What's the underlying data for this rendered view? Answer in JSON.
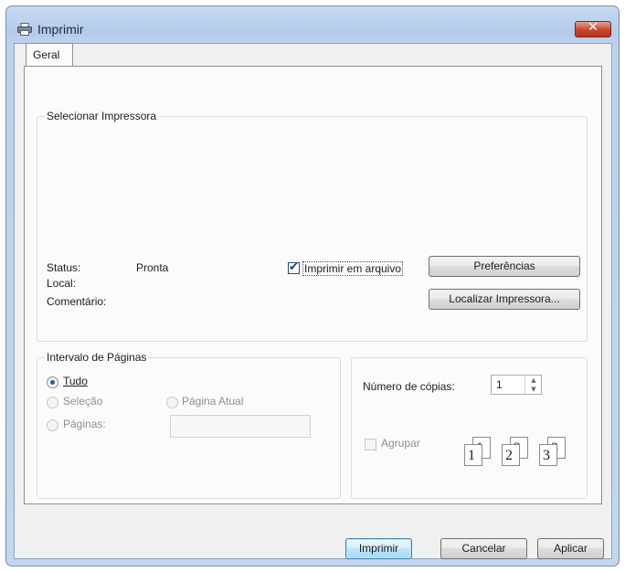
{
  "window": {
    "title": "Imprimir",
    "close_symbol": "✕"
  },
  "tabs": [
    {
      "label": "Geral"
    }
  ],
  "printer_group": {
    "legend": "Selecionar Impressora",
    "status_label": "Status:",
    "status_value": "Pronta",
    "location_label": "Local:",
    "comment_label": "Comentário:",
    "print_to_file_label": "Imprimir em arquivo",
    "print_to_file_checked": true,
    "preferences_button": "Preferências",
    "find_printer_button": "Localizar Impressora..."
  },
  "page_range": {
    "legend": "Intervalo de Páginas",
    "all_label": "Tudo",
    "selection_label": "Seleção",
    "current_page_label": "Página Atual",
    "pages_label": "Páginas:",
    "pages_value": ""
  },
  "copies": {
    "count_label": "Número de cópias:",
    "count_value": "1",
    "collate_label": "Agrupar",
    "collate_checked": false,
    "collate_pages": [
      "1",
      "1",
      "2",
      "2",
      "3",
      "3"
    ]
  },
  "footer": {
    "print_button": "Imprimir",
    "cancel_button": "Cancelar",
    "apply_button": "Aplicar"
  },
  "icons": {
    "printer": "printer-icon",
    "spin_up": "▲",
    "spin_down": "▼",
    "check_mark": "✔"
  }
}
